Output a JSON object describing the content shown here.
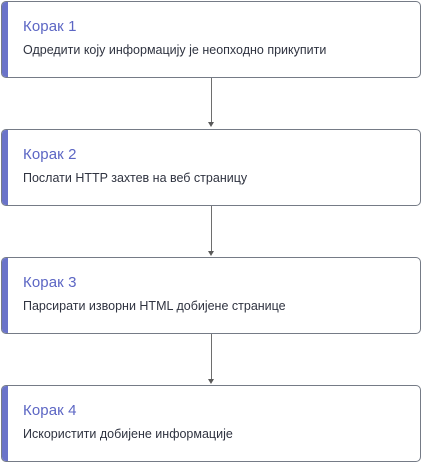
{
  "steps": [
    {
      "title": "Корак 1",
      "description": "Одредити коју информацију је неопходно прикупити"
    },
    {
      "title": "Корак 2",
      "description": "Послати HTTP захтев на веб страницу"
    },
    {
      "title": "Корак 3",
      "description": "Парсирати изворни HTML добијене странице"
    },
    {
      "title": "Корак 4",
      "description": "Искористити добијене информације"
    }
  ],
  "colors": {
    "accent": "#6a73c9",
    "title": "#5c66c4",
    "border": "#757b86",
    "text": "#2f3340",
    "connector": "#6e6e6e"
  }
}
